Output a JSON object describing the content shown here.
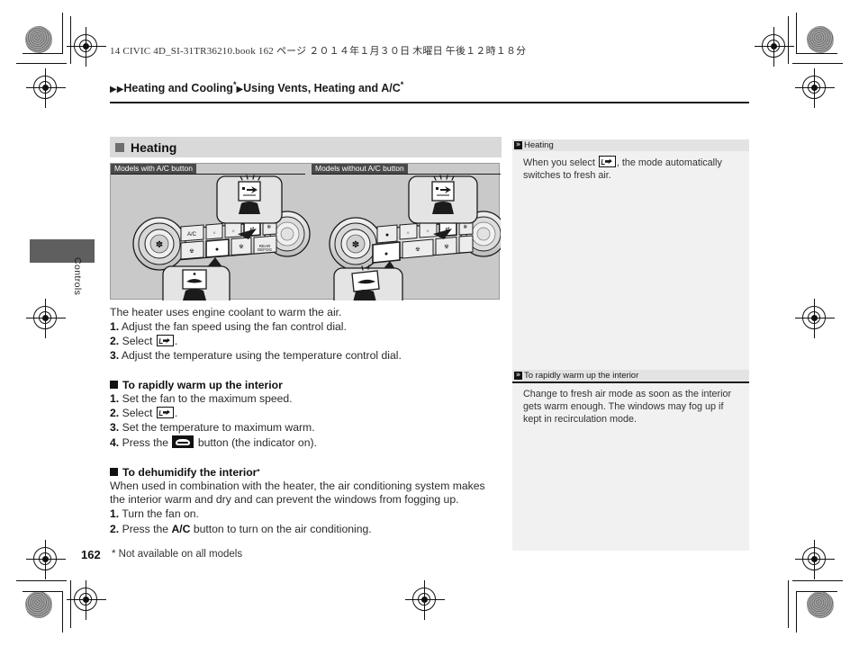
{
  "document": {
    "book_line": "14 CIVIC 4D_SI-31TR36210.book   162 ページ   ２０１４年１月３０日   木曜日   午後１２時１８分",
    "page_number": "162",
    "footnote": "* Not available on all models"
  },
  "breadcrumb": {
    "arrow": "▶",
    "level1": "Heating and Cooling",
    "level2": "Using Vents, Heating and A/C",
    "asterisk": "*"
  },
  "side_tab": {
    "label": "Controls"
  },
  "section": {
    "title": "Heating",
    "figure": {
      "caption_left": "Models with A/C button",
      "caption_right": "Models without A/C button",
      "callout_icon_top": "recirculation-fresh-air-button",
      "callout_icon_bottom": "mode-control-button",
      "panel_buttons_left": [
        "A/C",
        "defrost",
        "rear-defog",
        "recirculation",
        "off"
      ],
      "panel_buttons_right": [
        "mode",
        "defrost",
        "rear-defog",
        "recirculation",
        "off"
      ]
    },
    "intro": "The heater uses engine coolant to warm the air.",
    "steps": [
      {
        "n": "1.",
        "text": "Adjust the fan speed using the fan control dial."
      },
      {
        "n": "2.",
        "pre": "Select ",
        "icon": "fresh-air-icon",
        "post": "."
      },
      {
        "n": "3.",
        "text": "Adjust the temperature using the temperature control dial."
      }
    ]
  },
  "rapid_warm": {
    "heading": "To rapidly warm up the interior",
    "steps": [
      {
        "n": "1.",
        "text": "Set the fan to the maximum speed."
      },
      {
        "n": "2.",
        "pre": "Select ",
        "icon": "fresh-air-icon",
        "post": "."
      },
      {
        "n": "3.",
        "text": "Set the temperature to maximum warm."
      },
      {
        "n": "4.",
        "pre": "Press the ",
        "icon": "rear-defog-icon",
        "post": " button (the indicator on)."
      }
    ]
  },
  "dehumidify": {
    "heading": "To dehumidify the interior",
    "heading_asterisk": "*",
    "paragraph": "When used in combination with the heater, the air conditioning system makes the interior warm and dry and can prevent the windows from fogging up.",
    "steps": [
      {
        "n": "1.",
        "text": "Turn the fan on."
      },
      {
        "n": "2.",
        "pre": "Press the ",
        "bold": "A/C",
        "post": " button to turn on the air conditioning."
      }
    ]
  },
  "sidebar": {
    "notes": [
      {
        "marker": "≫",
        "title": "Heating",
        "pre": "When you select ",
        "icon": "fresh-air-icon",
        "post": ", the mode automatically switches to fresh air."
      },
      {
        "marker": "≫",
        "title": "To rapidly warm up the interior",
        "pre": "Change to fresh air mode as soon as the interior gets warm enough. The windows may fog up if kept in recirculation mode.",
        "icon": "",
        "post": ""
      }
    ]
  },
  "colors": {
    "section_header_bg": "#d9d9d9",
    "figure_bg": "#c9c9c9",
    "caption_bg": "#4a4a4a",
    "sidebar_bg": "#f1f1f1",
    "note_header_bg": "#e3e3e3",
    "tab_block": "#5f5f5f",
    "text": "#231f20"
  }
}
